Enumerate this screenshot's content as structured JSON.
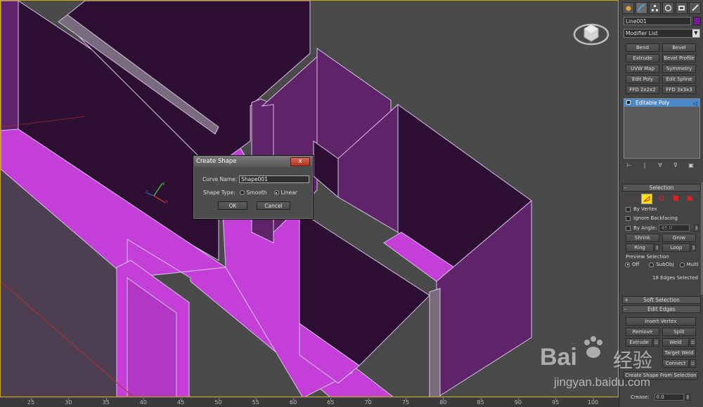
{
  "dialog": {
    "title": "Create Shape",
    "close_glyph": "x",
    "curve_name_label": "Curve Name:",
    "curve_name_value": "Shape001",
    "shape_type_label": "Shape Type:",
    "smooth_label": "Smooth",
    "linear_label": "Linear",
    "ok_label": "OK",
    "cancel_label": "Cancel"
  },
  "ruler": {
    "labels": [
      "25",
      "30",
      "35",
      "40",
      "45",
      "50",
      "55",
      "60",
      "65",
      "70",
      "75",
      "80",
      "85",
      "90",
      "95",
      "100"
    ]
  },
  "panel": {
    "object_name": "Line001",
    "object_color": "#7a169a",
    "modifier_list": "Modifier List",
    "modifier_buttons": [
      "Bend",
      "Bevel",
      "Extrude",
      "Bevel Profile",
      "UVW Map",
      "Symmetry",
      "Edit Poly",
      "Edit Spline",
      "FFD 2x2x2",
      "FFD 3x3x3"
    ],
    "stack_item": "Editable Poly",
    "selection": {
      "title": "Selection",
      "by_vertex": "By Vertex",
      "ignore_backfacing": "Ignore Backfacing",
      "by_angle": "By Angle:",
      "angle_value": "45.0",
      "shrink": "Shrink",
      "grow": "Grow",
      "ring": "Ring",
      "loop": "Loop",
      "preview_label": "Preview Selection",
      "preview_off": "Off",
      "preview_subobj": "SubObj",
      "preview_multi": "Multi",
      "status": "18 Edges Selected"
    },
    "soft_selection": "Soft Selection",
    "edit_edges": {
      "title": "Edit Edges",
      "insert_vertex": "Insert Vertex",
      "remove": "Remove",
      "split": "Split",
      "extrude": "Extrude",
      "weld": "Weld",
      "target_weld": "Target Weld",
      "connect": "Connect",
      "create_shape": "Create Shape From Selection",
      "crease_label": "Crease:",
      "crease_value": "0.0"
    }
  },
  "watermark": {
    "brand": "Bai",
    "brand_suffix": "经验",
    "url": "jingyan.baidu.com"
  },
  "colors": {
    "magenta": "#c43fd8",
    "dark_purple": "#2d0f33",
    "mid_purple": "#5e2368",
    "viewport_bg": "#4a4a4a",
    "accent_blue": "#4d89c7"
  }
}
